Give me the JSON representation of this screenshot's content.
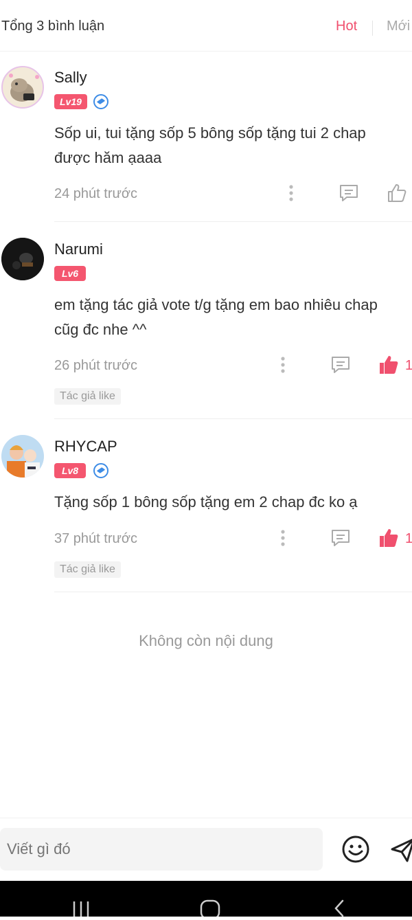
{
  "header": {
    "total": "Tổng 3 bình luận",
    "sort_hot": "Hot",
    "sort_new": "Mới"
  },
  "comments": [
    {
      "username": "Sally",
      "level": "Lv19",
      "verified": true,
      "text_lines": [
        "Sốp ui, tui tặng sốp 5 bông sốp tặng tui 2 chap",
        "được hăm ạaaa"
      ],
      "time": "24 phút trước",
      "liked": false,
      "like_count": "",
      "author_like": ""
    },
    {
      "username": "Narumi",
      "level": "Lv6",
      "verified": false,
      "text_lines": [
        "em tặng tác giả vote t/g tặng em bao nhiêu chap",
        "cũg đc nhe ^^"
      ],
      "time": "26 phút trước",
      "liked": true,
      "like_count": "1",
      "author_like": "Tác giả like"
    },
    {
      "username": "RHYCAP",
      "level": "Lv8",
      "verified": true,
      "text_lines": [
        "Tặng sốp 1 bông sốp tặng em 2 chap đc ko ạ"
      ],
      "time": "37 phút trước",
      "liked": true,
      "like_count": "1",
      "author_like": "Tác giả like"
    }
  ],
  "footer": {
    "no_more": "Không còn nội dung"
  },
  "input": {
    "placeholder": "Viết gì đó"
  },
  "icons": {
    "more": "more-vertical-icon",
    "reply": "comment-icon",
    "like": "thumbs-up-icon",
    "emoji": "smiley-icon",
    "send": "send-icon",
    "verified": "verified-badge-icon"
  },
  "colors": {
    "accent": "#f0506e",
    "level_badge": "#f4566f",
    "verified": "#3d8ce6",
    "muted": "#999999"
  }
}
